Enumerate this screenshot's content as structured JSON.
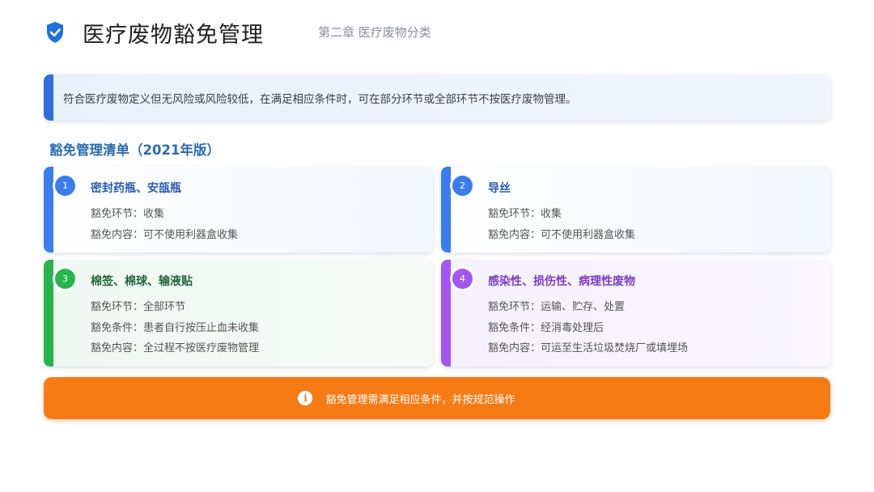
{
  "header": {
    "title": "医疗废物豁免管理",
    "subtitle": "第二章 医疗废物分类",
    "icon": "shield-check-icon"
  },
  "intro": {
    "text": "符合医疗废物定义但无风险或风险较低，在满足相应条件时，可在部分环节或全部环节不按医疗废物管理。"
  },
  "section": {
    "title": "豁免管理清单（2021年版）"
  },
  "cards": [
    {
      "number": "1",
      "title": "密封药瓶、安瓿瓶",
      "color": "#3b7ded",
      "lines": [
        "豁免环节：收集",
        "豁免内容：可不使用利器盒收集"
      ]
    },
    {
      "number": "2",
      "title": "导丝",
      "color": "#3b7ded",
      "lines": [
        "豁免环节：收集",
        "豁免内容：可不使用利器盒收集"
      ]
    },
    {
      "number": "3",
      "title": "棉签、棉球、输液贴",
      "color": "#27b54b",
      "lines": [
        "豁免环节：全部环节",
        "豁免条件：患者自行按压止血未收集",
        "豁免内容：全过程不按医疗废物管理"
      ]
    },
    {
      "number": "4",
      "title": "感染性、损伤性、病理性废物",
      "color": "#a556f0",
      "lines": [
        "豁免环节：运输、贮存、处置",
        "豁免条件：经消毒处理后",
        "豁免内容：可运至生活垃圾焚烧厂或填埋场"
      ]
    }
  ],
  "notice": {
    "icon": "info-icon",
    "text": "豁免管理需满足相应条件，并按规范操作",
    "color": "#f67b15"
  }
}
